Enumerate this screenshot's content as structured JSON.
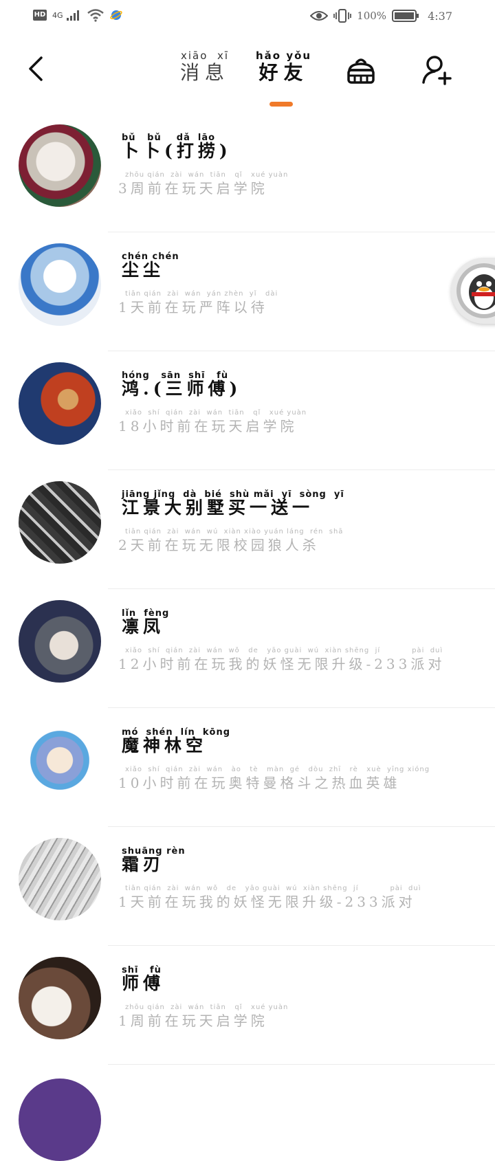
{
  "statusbar": {
    "hd": "HD",
    "network": "4G",
    "battery_text": "100%",
    "time": "4:37"
  },
  "header": {
    "tabs": [
      {
        "pinyin": "xiāo  xī",
        "label": "消息",
        "active": false
      },
      {
        "pinyin": "hǎo yǒu",
        "label": "好友",
        "active": true
      }
    ],
    "accent_color": "#f07a2a",
    "icons": [
      "back-icon",
      "clean-icon",
      "add-friend-icon"
    ]
  },
  "friends": [
    {
      "name_py": "bǔ   bǔ    dǎ  lāo",
      "name": "卜卜(打捞)",
      "status_py": "zhōu qián  zài  wán  tiān   qǐ   xué yuàn",
      "status": "3周前在玩天启学院"
    },
    {
      "name_py": "chén chén",
      "name": "尘尘",
      "status_py": "tiān qián  zài  wán  yán zhèn  yǐ   dài",
      "status": "1天前在玩严阵以待"
    },
    {
      "name_py": "hóng   sān  shī   fù",
      "name": "鸿.(三师傅)",
      "status_py": "xiǎo  shí  qián  zài  wán  tiān   qǐ   xué yuàn",
      "status": "18小时前在玩天启学院"
    },
    {
      "name_py": "jiāng jǐng  dà  bié  shù mǎi  yī  sòng  yī",
      "name": "江景大别墅买一送一",
      "status_py": "tiān qián  zài  wán  wú  xiàn xiào yuán láng  rén  shā",
      "status": "2天前在玩无限校园狼人杀"
    },
    {
      "name_py": "lǐn  fèng",
      "name": "凛凤",
      "status_py": "xiǎo  shí  qián  zài  wán  wǒ   de   yāo guài  wú  xiàn shēng  jí           pài  duì",
      "status": "12小时前在玩我的妖怪无限升级-233派对"
    },
    {
      "name_py": "mó  shén  lín  kōng",
      "name": "魔神林空",
      "status_py": "xiǎo  shí  qián  zài  wán   ào   tè   màn  gé   dòu  zhī   rè   xuè  yīng xióng",
      "status": "10小时前在玩奥特曼格斗之热血英雄"
    },
    {
      "name_py": "shuāng rèn",
      "name": "霜刃",
      "status_py": "tiān qián  zài  wán  wǒ   de   yāo guài  wú  xiàn shēng  jí           pài  duì",
      "status": "1天前在玩我的妖怪无限升级-233派对"
    },
    {
      "name_py": "shī   fù",
      "name": "师傅",
      "status_py": "zhōu qián  zài  wán  tiān   qǐ   xué yuàn",
      "status": "1周前在玩天启学院"
    }
  ]
}
